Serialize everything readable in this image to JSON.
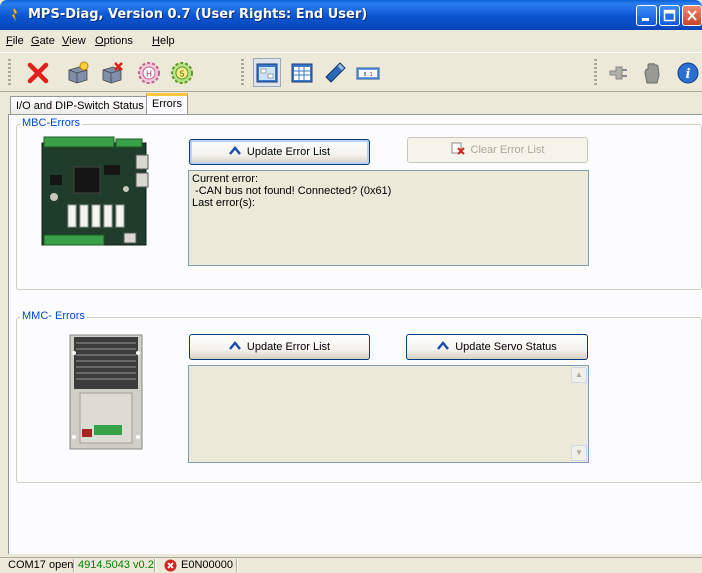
{
  "window": {
    "title": "MPS-Diag, Version 0.7 (User Rights: End User)"
  },
  "menu": [
    {
      "label": "File",
      "accel": "F",
      "rest": "ile"
    },
    {
      "label": "Gate",
      "accel": "G",
      "rest": "ate"
    },
    {
      "label": "View",
      "accel": "V",
      "rest": "iew"
    },
    {
      "label": "Options",
      "accel": "O",
      "rest": "ptions"
    },
    {
      "label": "Help",
      "accel": "H",
      "rest": "elp"
    }
  ],
  "toolbar": {
    "icons": [
      "delete-icon",
      "add-device-icon",
      "remove-device-icon",
      "home-gear-icon",
      "start-gear-icon",
      "panel-view-icon",
      "table-view-icon",
      "tool-icon",
      "display-icon",
      "plug-icon",
      "hand-icon",
      "info-icon"
    ]
  },
  "tabs": [
    {
      "label": "I/O and DIP-Switch Status",
      "active": false
    },
    {
      "label": "Errors",
      "active": true
    }
  ],
  "mbc": {
    "group_label": "MBC-Errors",
    "update_button": "Update Error List",
    "clear_button": "Clear Error List",
    "error_text": "Current error:\n -CAN bus not found! Connected? (0x61)\nLast error(s):"
  },
  "mmc": {
    "group_label": "MMC- Errors",
    "update_button": "Update Error List",
    "servo_button": "Update Servo Status",
    "error_text": ""
  },
  "status": {
    "port": "COM17 open",
    "version": "4914.5043 v0.2",
    "error_code": "E0N00000",
    "version_color": "#008000",
    "error_color": "#d0241c"
  }
}
